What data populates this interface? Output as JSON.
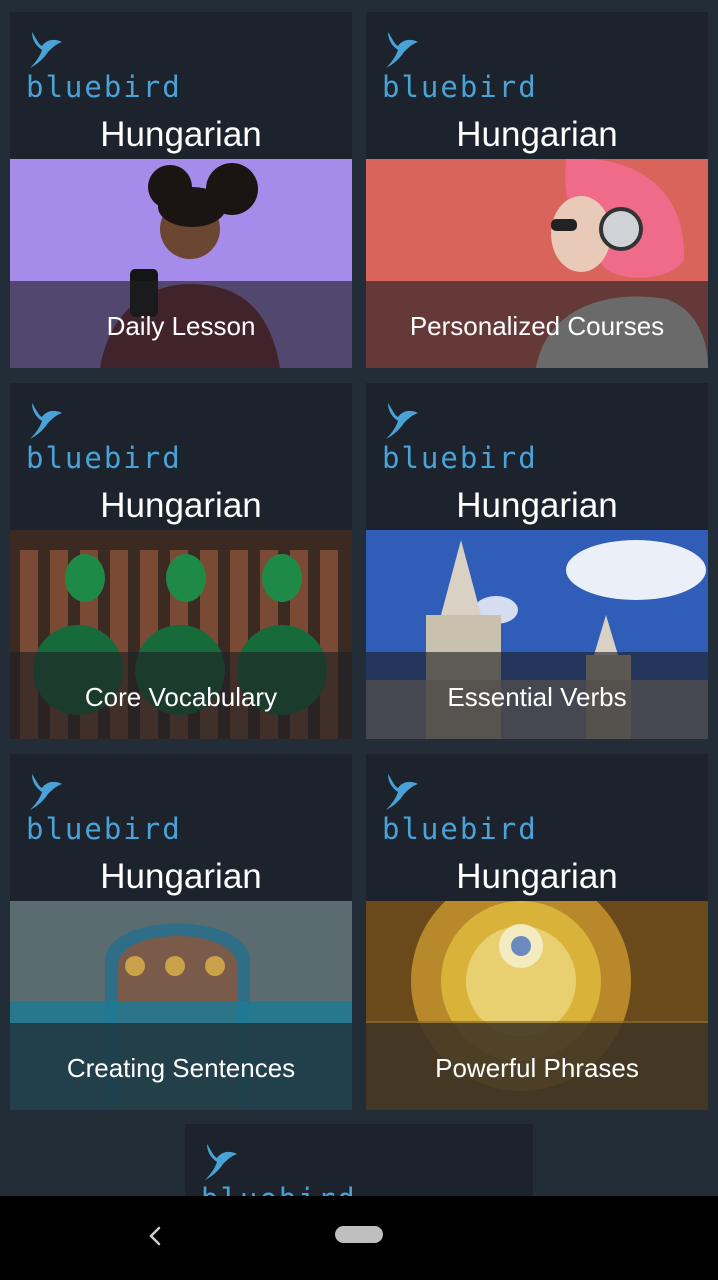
{
  "cards": [
    {
      "brand": "bluebird",
      "language": "Hungarian",
      "title": "Daily Lesson"
    },
    {
      "brand": "bluebird",
      "language": "Hungarian",
      "title": "Personalized Courses"
    },
    {
      "brand": "bluebird",
      "language": "Hungarian",
      "title": "Core Vocabulary"
    },
    {
      "brand": "bluebird",
      "language": "Hungarian",
      "title": "Essential Verbs"
    },
    {
      "brand": "bluebird",
      "language": "Hungarian",
      "title": "Creating Sentences"
    },
    {
      "brand": "bluebird",
      "language": "Hungarian",
      "title": "Powerful Phrases"
    }
  ],
  "partial_card": {
    "brand": "bluebird"
  },
  "colors": {
    "brand_blue": "#4aa3d8",
    "card_bg": "#1c232c",
    "page_bg": "#232d38"
  },
  "navigation": {
    "back_icon": "chevron-left-icon",
    "home_icon": "home-pill-icon"
  }
}
